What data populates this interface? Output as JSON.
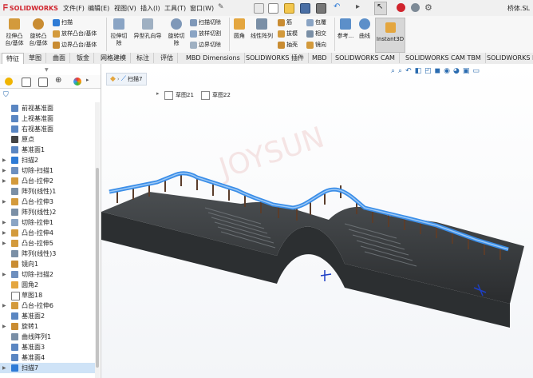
{
  "app": {
    "logo_text": "SOLIDWORKS",
    "window_title": "桥体.SL"
  },
  "menu": [
    "文件(F)",
    "编辑(E)",
    "视图(V)",
    "插入(I)",
    "工具(T)",
    "窗口(W)"
  ],
  "ribbon": {
    "boss_extrude": "拉伸凸台/基体",
    "boss_revolve": "旋转凸台/基体",
    "sweep": "扫描",
    "loft_boss": "放样凸台/基体",
    "boundary_boss": "边界凸台/基体",
    "extrude_cut": "拉伸切除",
    "hole_wizard": "异型孔向导",
    "revolve_cut": "旋转切除",
    "swept_cut": "扫描切除",
    "lofted_cut": "放样切割",
    "boundary_cut": "边界切除",
    "fillet": "圆角",
    "linear_pattern": "线性阵列",
    "rib": "筋",
    "draft": "拔模",
    "shell": "抽壳",
    "wrap": "包覆",
    "intersect": "相交",
    "mirror": "镜向",
    "reference": "参考...",
    "curves": "曲线",
    "instant3d": "Instant3D"
  },
  "tabs": [
    "特征",
    "草图",
    "曲面",
    "钣金",
    "网格建模",
    "标注",
    "评估",
    "MBD Dimensions",
    "SOLIDWORKS 插件",
    "MBD",
    "SOLIDWORKS CAM",
    "SOLIDWORKS CAM TBM",
    "SOLIDWORKS In"
  ],
  "tree": [
    {
      "label": "前视基准面",
      "icon": "plane-icon",
      "arrow": ""
    },
    {
      "label": "上视基准面",
      "icon": "plane-icon",
      "arrow": ""
    },
    {
      "label": "右视基准面",
      "icon": "plane-icon",
      "arrow": ""
    },
    {
      "label": "原点",
      "icon": "origin-icon",
      "arrow": ""
    },
    {
      "label": "基准面1",
      "icon": "plane-icon",
      "arrow": ""
    },
    {
      "label": "扫描2",
      "icon": "sweep-icon",
      "arrow": "▶"
    },
    {
      "label": "切除-扫描1",
      "icon": "sweep-cut-icon",
      "arrow": "▶"
    },
    {
      "label": "凸台-拉伸2",
      "icon": "extrude-icon",
      "arrow": "▶"
    },
    {
      "label": "阵列(线性)1",
      "icon": "pattern-icon",
      "arrow": ""
    },
    {
      "label": "凸台-拉伸3",
      "icon": "extrude-icon",
      "arrow": "▶"
    },
    {
      "label": "阵列(线性)2",
      "icon": "pattern-icon",
      "arrow": ""
    },
    {
      "label": "切除-拉伸1",
      "icon": "extrude-cut-icon",
      "arrow": "▶"
    },
    {
      "label": "凸台-拉伸4",
      "icon": "extrude-icon",
      "arrow": "▶"
    },
    {
      "label": "凸台-拉伸5",
      "icon": "extrude-icon",
      "arrow": "▶"
    },
    {
      "label": "阵列(线性)3",
      "icon": "pattern-icon",
      "arrow": ""
    },
    {
      "label": "镜向1",
      "icon": "mirror-icon",
      "arrow": ""
    },
    {
      "label": "切除-扫描2",
      "icon": "sweep-cut-icon",
      "arrow": "▶"
    },
    {
      "label": "圆角2",
      "icon": "fillet-icon",
      "arrow": ""
    },
    {
      "label": "草图18",
      "icon": "sketch-icon",
      "arrow": ""
    },
    {
      "label": "凸台-拉伸6",
      "icon": "extrude-icon",
      "arrow": "▶"
    },
    {
      "label": "基准面2",
      "icon": "plane-icon",
      "arrow": ""
    },
    {
      "label": "旋转1",
      "icon": "revolve-icon",
      "arrow": "▶"
    },
    {
      "label": "曲线阵列1",
      "icon": "curve-pattern-icon",
      "arrow": ""
    },
    {
      "label": "基准面3",
      "icon": "plane-icon",
      "arrow": ""
    },
    {
      "label": "基准面4",
      "icon": "plane-icon",
      "arrow": ""
    },
    {
      "label": "扫描7",
      "icon": "sweep-icon",
      "arrow": "▶",
      "selected": true
    }
  ],
  "breadcrumb": {
    "current": "扫描7"
  },
  "popup": {
    "item1": "草图21",
    "item2": "草图22"
  },
  "watermark": "JOYSUN",
  "colors": {
    "accent": "#2e7bd6",
    "brand": "#d0242d",
    "selection": "#cfe3f7",
    "rail": "#3b8ee8",
    "deck": "#3a3d3f"
  }
}
